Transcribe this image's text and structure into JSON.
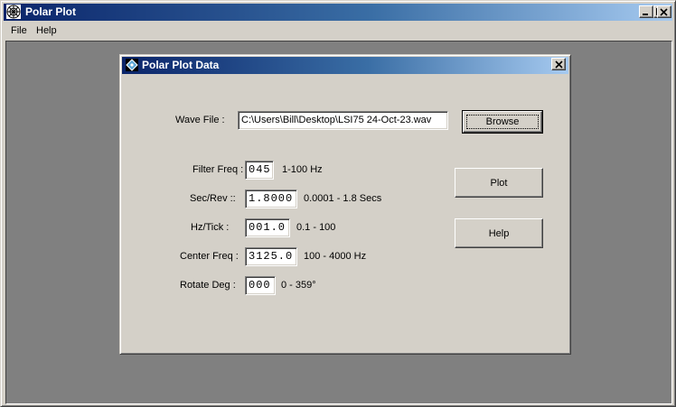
{
  "app": {
    "title": "Polar Plot",
    "icon": "polar-plot-icon"
  },
  "menu": {
    "items": [
      {
        "label": "File"
      },
      {
        "label": "Help"
      }
    ]
  },
  "dialog": {
    "title": "Polar Plot Data",
    "icon": "diamond-icon",
    "wave_file": {
      "label": "Wave File :",
      "value": "C:\\Users\\Bill\\Desktop\\LSI75 24-Oct-23.wav"
    },
    "fields": [
      {
        "label": "Filter Freq :",
        "value": "045",
        "range": "1-100 Hz"
      },
      {
        "label": "Sec/Rev ::",
        "value": "1.8000",
        "range": "0.0001 - 1.8 Secs"
      },
      {
        "label": "Hz/Tick :",
        "value": "001.0",
        "range": "0.1 - 100"
      },
      {
        "label": "Center Freq :",
        "value": "3125.0",
        "range": "100 - 4000 Hz"
      },
      {
        "label": "Rotate Deg :",
        "value": "000",
        "range": "0 - 359°"
      }
    ],
    "buttons": {
      "browse": "Browse",
      "plot": "Plot",
      "help": "Help"
    }
  }
}
